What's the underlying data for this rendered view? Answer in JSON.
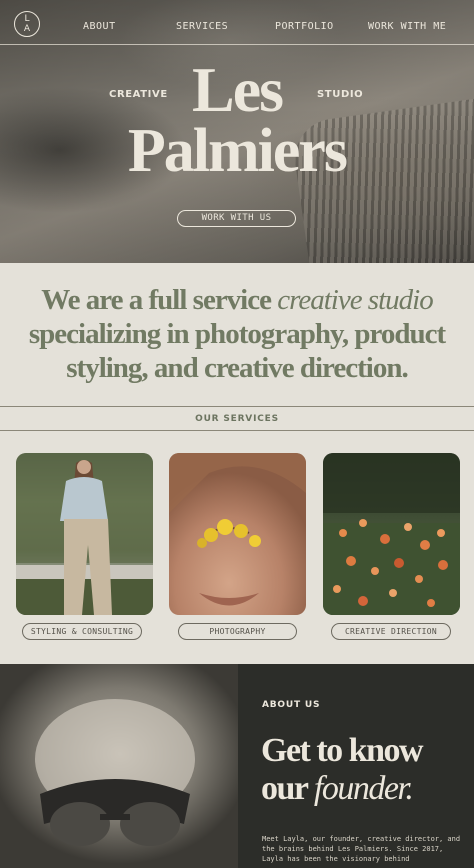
{
  "nav": {
    "logo_top": "L",
    "logo_bottom": "A",
    "links": [
      "ABOUT",
      "SERVICES",
      "PORTFOLIO",
      "WORK WITH ME"
    ]
  },
  "hero": {
    "left_label": "CREATIVE",
    "right_label": "STUDIO",
    "brand_line1": "Les",
    "brand_line2": "Palmiers",
    "cta": "WORK WITH US"
  },
  "intro": {
    "part1": "We are a full service ",
    "italic": "creative studio",
    "part2": " specializing in photography, product styling, and creative direction."
  },
  "services": {
    "title": "OUR SERVICES",
    "items": [
      {
        "label": "STYLING & CONSULTING"
      },
      {
        "label": "PHOTOGRAPHY"
      },
      {
        "label": "CREATIVE DIRECTION"
      }
    ]
  },
  "about": {
    "label": "ABOUT US",
    "heading_line1": "Get to know",
    "heading_line2_plain": "our ",
    "heading_line2_italic": "founder.",
    "body": "Meet Layla, our founder, creative director, and the brains behind Les Palmiers. Since 2017, Layla has been the visionary behind"
  },
  "colors": {
    "olive_text": "#717a63",
    "cream": "#e4e1d9",
    "dark_panel": "#2c2d29"
  }
}
